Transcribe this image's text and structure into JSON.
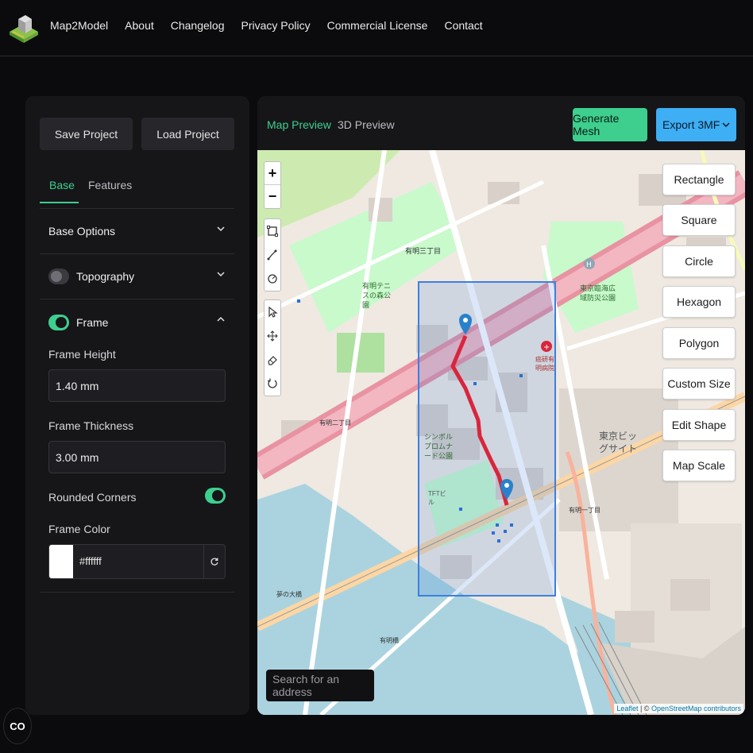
{
  "header": {
    "brand": "Map2Model",
    "nav": [
      "About",
      "Changelog",
      "Privacy Policy",
      "Commercial License",
      "Contact"
    ]
  },
  "left_panel": {
    "save_label": "Save Project",
    "load_label": "Load Project",
    "tabs": [
      "Base",
      "Features"
    ],
    "active_tab": "Base",
    "sections": {
      "base_options": "Base Options",
      "topography": "Topography",
      "frame": "Frame"
    },
    "topography_enabled": false,
    "frame_enabled": true,
    "frame_height_label": "Frame Height",
    "frame_height_value": "1.40 mm",
    "frame_thickness_label": "Frame Thickness",
    "frame_thickness_value": "3.00 mm",
    "rounded_corners_label": "Rounded Corners",
    "rounded_corners_enabled": true,
    "frame_color_label": "Frame Color",
    "frame_color_value": "#ffffff"
  },
  "right_panel": {
    "tabs": [
      "Map Preview",
      "3D Preview"
    ],
    "active_tab": "Map Preview",
    "generate_label": "Generate Mesh",
    "export_label": "Export 3MF",
    "zoom_in": "+",
    "zoom_out": "−",
    "shape_buttons": [
      "Rectangle",
      "Square",
      "Circle",
      "Hexagon",
      "Polygon",
      "Custom Size",
      "Edit Shape",
      "Map Scale"
    ],
    "search_placeholder": "Search for an address",
    "attribution_leaflet": "Leaflet",
    "attribution_sep": " | © ",
    "attribution_osm": "OpenStreetMap contributors"
  },
  "map_labels": {
    "ariake_3": "有明三丁目",
    "ariake_2": "有明二丁目",
    "ariake_1": "有明一丁目",
    "tennis": "有明テニスの森公園",
    "bigsight": "東京ビッグサイト",
    "disaster_park": "東京臨海広域防災公園",
    "hospital": "癌研有明病院",
    "tft": "TFTビル",
    "symbol": "シンボルプロムナード公園",
    "yume_bridge": "夢の大橋",
    "ariake_bridge": "有明橋"
  },
  "colors": {
    "accent_green": "#3ecf8e",
    "accent_blue": "#3eaef5",
    "route_red": "#d9263c",
    "selection_blue": "#3d7fe0"
  },
  "fab_label": "CO"
}
